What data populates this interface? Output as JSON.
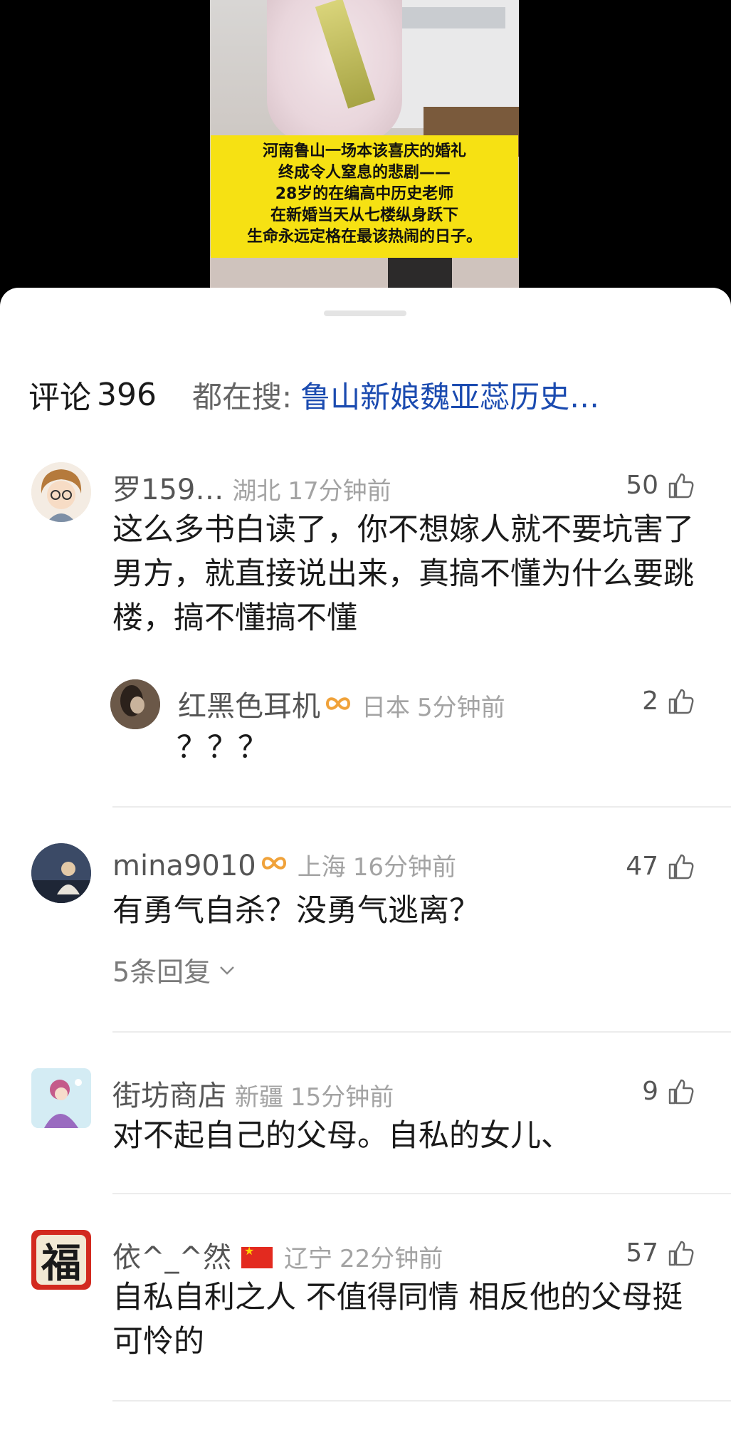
{
  "video": {
    "caption_lines": [
      "河南鲁山一场本该喜庆的婚礼",
      "终成令人窒息的悲剧——",
      "28岁的在编高中历史老师",
      "在新婚当天从七楼纵身跃下",
      "生命永远定格在最该热闹的日子。"
    ]
  },
  "comments_header": {
    "title": "评论",
    "count": "396",
    "search_label": "都在搜:",
    "search_term": "鲁山新娘魏亚蕊历史…"
  },
  "comments": [
    {
      "username": "罗159…",
      "location": "湖北",
      "time": "17分钟前",
      "likes": "50",
      "text": "这么多书白读了，你不想嫁人就不要坑害了男方，就直接说出来，真搞不懂为什么要跳楼，搞不懂搞不懂",
      "reply": {
        "username": "红黑色耳机",
        "location": "日本",
        "time": "5分钟前",
        "likes": "2",
        "text": "？？？"
      }
    },
    {
      "username": "mina9010",
      "location": "上海",
      "time": "16分钟前",
      "likes": "47",
      "text": "有勇气自杀？没勇气逃离？",
      "replies_link": "5条回复"
    },
    {
      "username": "街坊商店",
      "location": "新疆",
      "time": "15分钟前",
      "likes": "9",
      "text": "对不起自己的父母。自私的女儿、"
    },
    {
      "username": "依^_^然",
      "location": "辽宁",
      "time": "22分钟前",
      "likes": "57",
      "text": "自私自利之人 不值得同情  相反他的父母挺可怜的",
      "avatar_char": "福"
    }
  ],
  "colors": {
    "caption_bg": "#f6e113",
    "link_blue": "#1b4bb0",
    "badge_orange": "#f0a23a",
    "flag_red": "#e32a1f"
  }
}
